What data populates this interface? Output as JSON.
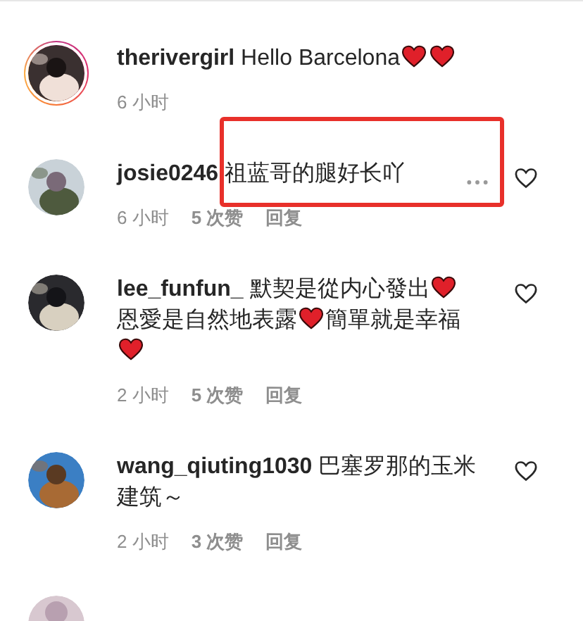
{
  "comments": [
    {
      "kind": "comment",
      "avatar_ring": true,
      "username": "therivergirl",
      "body": [
        {
          "kind": "text",
          "text": "Hello Barcelona"
        },
        {
          "kind": "heart"
        },
        {
          "kind": "heart"
        }
      ],
      "time": "6 小时",
      "like_button": false,
      "more": false,
      "highlighted": false
    },
    {
      "kind": "comment",
      "avatar_ring": false,
      "username": "josie0246",
      "body": [
        {
          "kind": "text",
          "text": "祖蓝哥的腿好长吖"
        }
      ],
      "time": "6 小时",
      "likes": "5 次赞",
      "reply": "回复",
      "like_button": true,
      "more": true,
      "highlighted": true
    },
    {
      "kind": "comment",
      "avatar_ring": false,
      "username": "lee_funfun_",
      "body": [
        {
          "kind": "text",
          "text": "默契是從内心發出"
        },
        {
          "kind": "heart"
        },
        {
          "kind": "text",
          "text": "恩愛是自然地表露"
        },
        {
          "kind": "heart"
        },
        {
          "kind": "text",
          "text": "簡單就是幸福"
        },
        {
          "kind": "heart"
        }
      ],
      "time": "2 小时",
      "likes": "5 次赞",
      "reply": "回复",
      "like_button": true,
      "more": false,
      "highlighted": false
    },
    {
      "kind": "comment",
      "avatar_ring": false,
      "username": "wang_qiuting1030",
      "body": [
        {
          "kind": "text",
          "text": "巴塞罗那的玉米建筑～"
        }
      ],
      "time": "2 小时",
      "likes": "3 次赞",
      "reply": "回复",
      "like_button": true,
      "more": false,
      "highlighted": false
    },
    {
      "kind": "partial"
    }
  ]
}
